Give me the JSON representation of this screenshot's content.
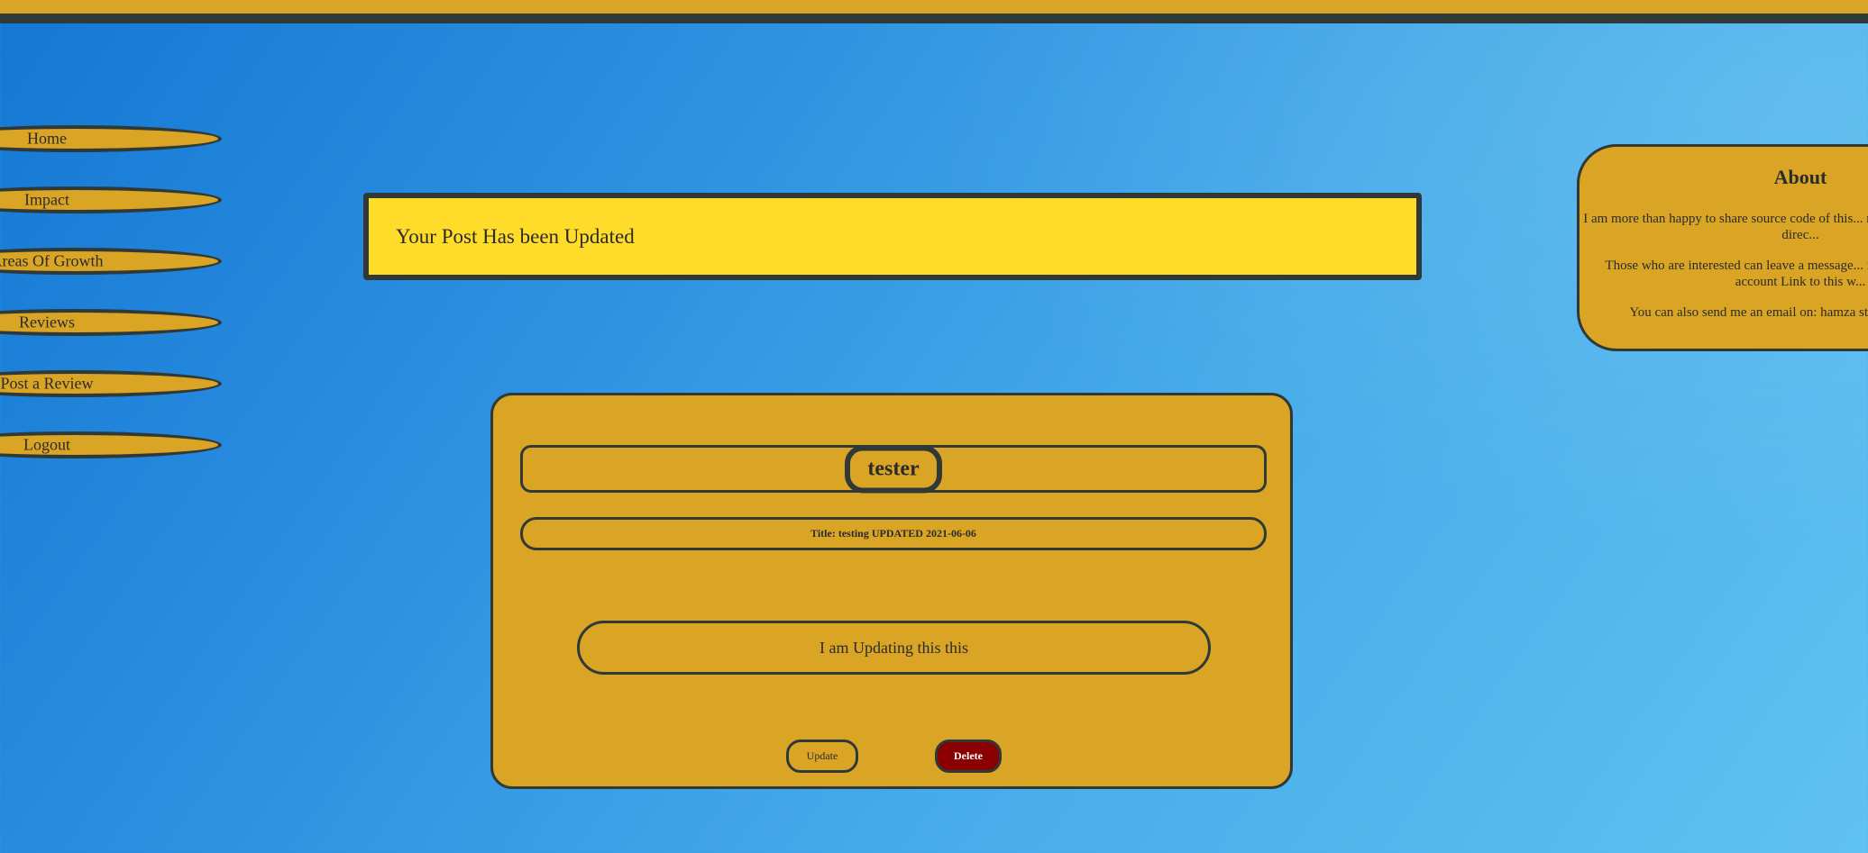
{
  "colors": {
    "accent": "#daa525",
    "border": "#2f3a38",
    "flash": "#fedc29",
    "delete": "#8b0000"
  },
  "sidebar": {
    "items": [
      {
        "label": "Home"
      },
      {
        "label": "Impact"
      },
      {
        "label": "Areas Of Growth"
      },
      {
        "label": "Reviews"
      },
      {
        "label": "Post a Review"
      },
      {
        "label": "Logout"
      }
    ]
  },
  "flash": {
    "message": "Your Post Has been Updated"
  },
  "about": {
    "title": "About",
    "paragraphs": [
      "I am more than happy to share source code of this... reasons I wont be providing direc...",
      "Those who are interested can leave a message... forward the My GitHub account Link to this w...",
      "You can also send me an email on: hamza stop kh... ucc plop ie"
    ]
  },
  "post": {
    "author": "tester",
    "title": "Title: testing UPDATED 2021-06-06",
    "body": "I am Updating this this",
    "update_label": "Update",
    "delete_label": "Delete"
  }
}
